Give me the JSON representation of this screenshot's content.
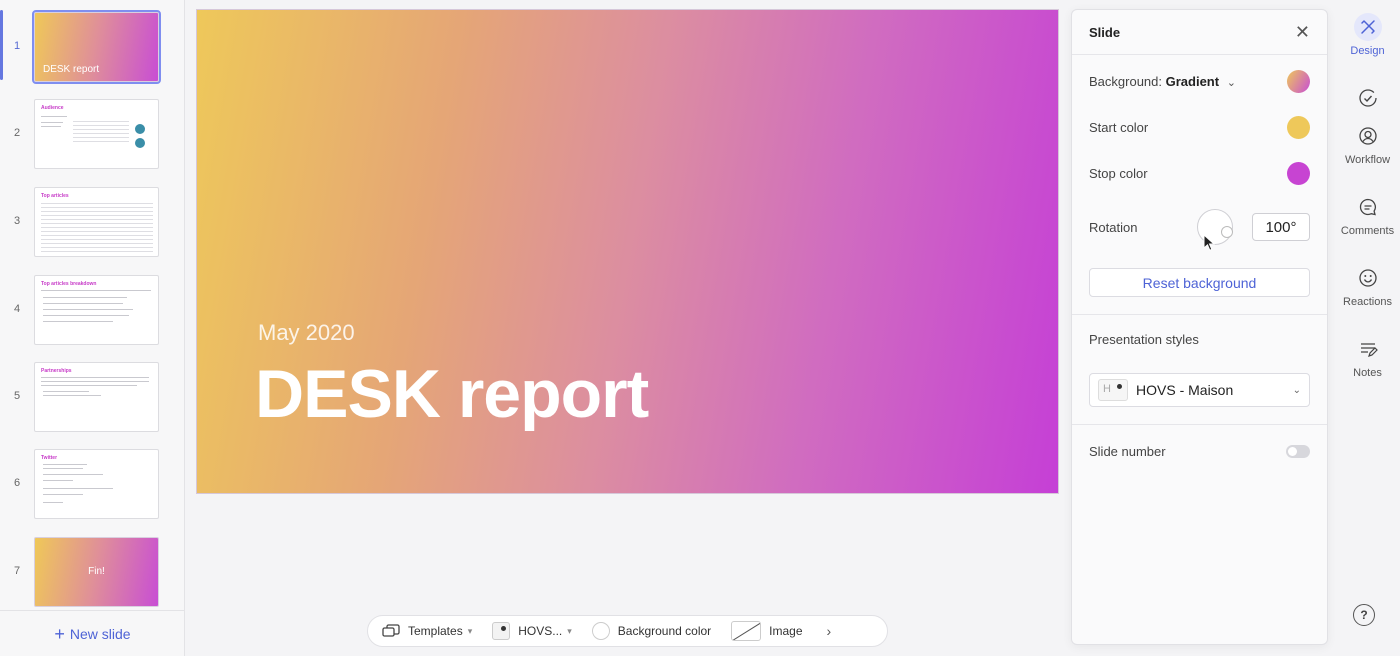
{
  "sidebar": {
    "slides": [
      {
        "number": "1",
        "title": "DESK report"
      },
      {
        "number": "2",
        "title": "Audience"
      },
      {
        "number": "3",
        "title": "Top articles"
      },
      {
        "number": "4",
        "title": "Top articles breakdown"
      },
      {
        "number": "5",
        "title": "Partnerships"
      },
      {
        "number": "6",
        "title": "Twitter"
      },
      {
        "number": "7",
        "title": "Fin!"
      }
    ],
    "new_slide_label": "New slide",
    "active_index": 1
  },
  "slide": {
    "date": "May 2020",
    "title": "DESK report",
    "gradient_colors": [
      "#eec85a",
      "#c53fd6"
    ]
  },
  "toolbar": {
    "templates_label": "Templates",
    "style_label": "HOVS...",
    "background_label": "Background color",
    "image_label": "Image"
  },
  "panel": {
    "title": "Slide",
    "background_label": "Background:",
    "background_value": "Gradient",
    "start_color_label": "Start color",
    "start_color": "#eec85a",
    "stop_color_label": "Stop color",
    "stop_color": "#c744d2",
    "rotation_label": "Rotation",
    "rotation_value": "100°",
    "reset_label": "Reset background",
    "presentation_styles_label": "Presentation styles",
    "presentation_style_value": "HOVS - Maison",
    "slide_number_label": "Slide number",
    "slide_number_enabled": false
  },
  "rail": {
    "design_label": "Design",
    "workflow_label": "Workflow",
    "comments_label": "Comments",
    "reactions_label": "Reactions",
    "notes_label": "Notes",
    "help_label": "?"
  },
  "colors": {
    "accent": "#4e63d6"
  }
}
